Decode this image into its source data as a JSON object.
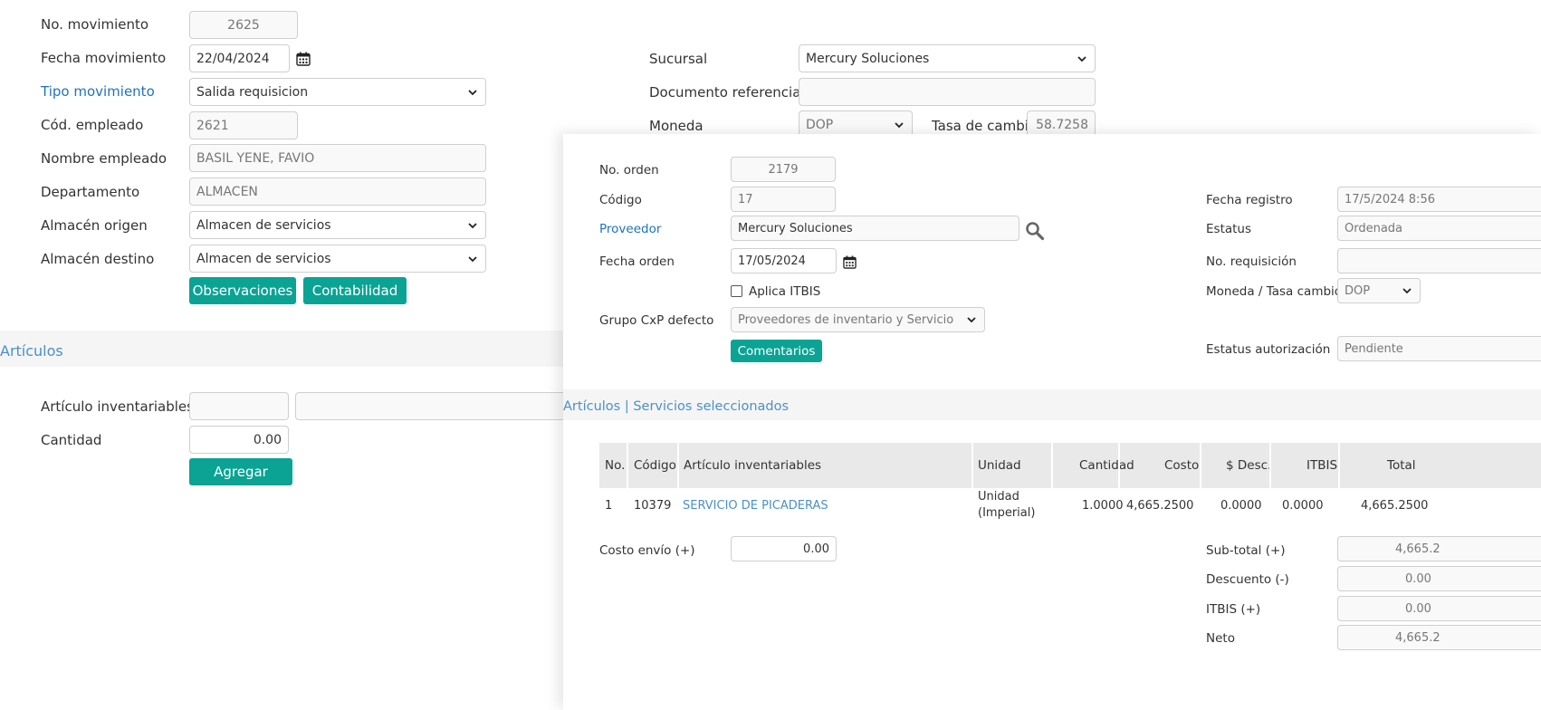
{
  "form": {
    "no_movimiento": {
      "label": "No. movimiento",
      "value": "2625"
    },
    "fecha_movimiento": {
      "label": "Fecha movimiento",
      "value": "22/04/2024"
    },
    "tipo_movimiento": {
      "label": "Tipo movimiento",
      "value": "Salida requisicion"
    },
    "cod_empleado": {
      "label": "Cód. empleado",
      "value": "2621"
    },
    "nombre_empleado": {
      "label": "Nombre empleado",
      "value": "BASIL YENE, FAVIO"
    },
    "departamento": {
      "label": "Departamento",
      "value": "ALMACEN"
    },
    "almacen_origen": {
      "label": "Almacén origen",
      "value": "Almacen de servicios"
    },
    "almacen_destino": {
      "label": "Almacén destino",
      "value": "Almacen de servicios"
    },
    "sucursal": {
      "label": "Sucursal",
      "value": "Mercury Soluciones"
    },
    "documento_referencia": {
      "label": "Documento referencia",
      "value": ""
    },
    "moneda": {
      "label": "Moneda",
      "value": "DOP"
    },
    "tasa_cambio": {
      "label": "Tasa de cambio",
      "value": "58.7258"
    },
    "buttons": {
      "observaciones": "Observaciones",
      "contabilidad": "Contabilidad"
    }
  },
  "articulos_section": {
    "title": "Artículos",
    "articulo_label": "Artículo inventariables",
    "articulo_code": "",
    "articulo_name": "",
    "cantidad_label": "Cantidad",
    "cantidad_value": "0.00",
    "agregar": "Agregar"
  },
  "overlay": {
    "no_orden": {
      "label": "No. orden",
      "value": "2179"
    },
    "codigo": {
      "label": "Código",
      "value": "17"
    },
    "proveedor": {
      "label": "Proveedor",
      "value": "Mercury Soluciones"
    },
    "fecha_orden": {
      "label": "Fecha orden",
      "value": "17/05/2024"
    },
    "aplica_itbis": {
      "label": "Aplica ITBIS",
      "checked": false
    },
    "grupo_cxp": {
      "label": "Grupo CxP defecto",
      "value": "Proveedores de inventario y Servicio"
    },
    "comentarios": "Comentarios",
    "fecha_registro": {
      "label": "Fecha registro",
      "value": "17/5/2024 8:56"
    },
    "estatus": {
      "label": "Estatus",
      "value": "Ordenada"
    },
    "no_requisicion": {
      "label": "No. requisición",
      "value": ""
    },
    "moneda_tasa": {
      "label": "Moneda / Tasa cambio",
      "value": "DOP"
    },
    "estatus_autorizacion": {
      "label": "Estatus autorización",
      "value": "Pendiente"
    },
    "section_title": "Artículos | Servicios seleccionados",
    "table": {
      "headers": [
        "No.",
        "Código",
        "Artículo inventariables",
        "Unidad",
        "Cantidad",
        "Costo",
        "$ Desc.",
        "ITBIS",
        "Total"
      ],
      "rows": [
        {
          "no": "1",
          "codigo": "10379",
          "articulo": "SERVICIO DE PICADERAS",
          "unidad_1": "Unidad",
          "unidad_2": "(Imperial)",
          "cantidad": "1.0000",
          "costo": "4,665.2500",
          "desc": "0.0000",
          "itbis": "0.0000",
          "total": "4,665.2500"
        }
      ]
    },
    "costo_envio": {
      "label": "Costo envío (+)",
      "value": "0.00"
    },
    "totals": {
      "subtotal": {
        "label": "Sub-total (+)",
        "value": "4,665.2"
      },
      "descuento": {
        "label": "Descuento (-)",
        "value": "0.00"
      },
      "itbis": {
        "label": "ITBIS (+)",
        "value": "0.00"
      },
      "neto": {
        "label": "Neto",
        "value": "4,665.2"
      }
    }
  },
  "colors": {
    "accent": "#0aa394",
    "link": "#1e73be",
    "section_title": "#4a90c8"
  }
}
